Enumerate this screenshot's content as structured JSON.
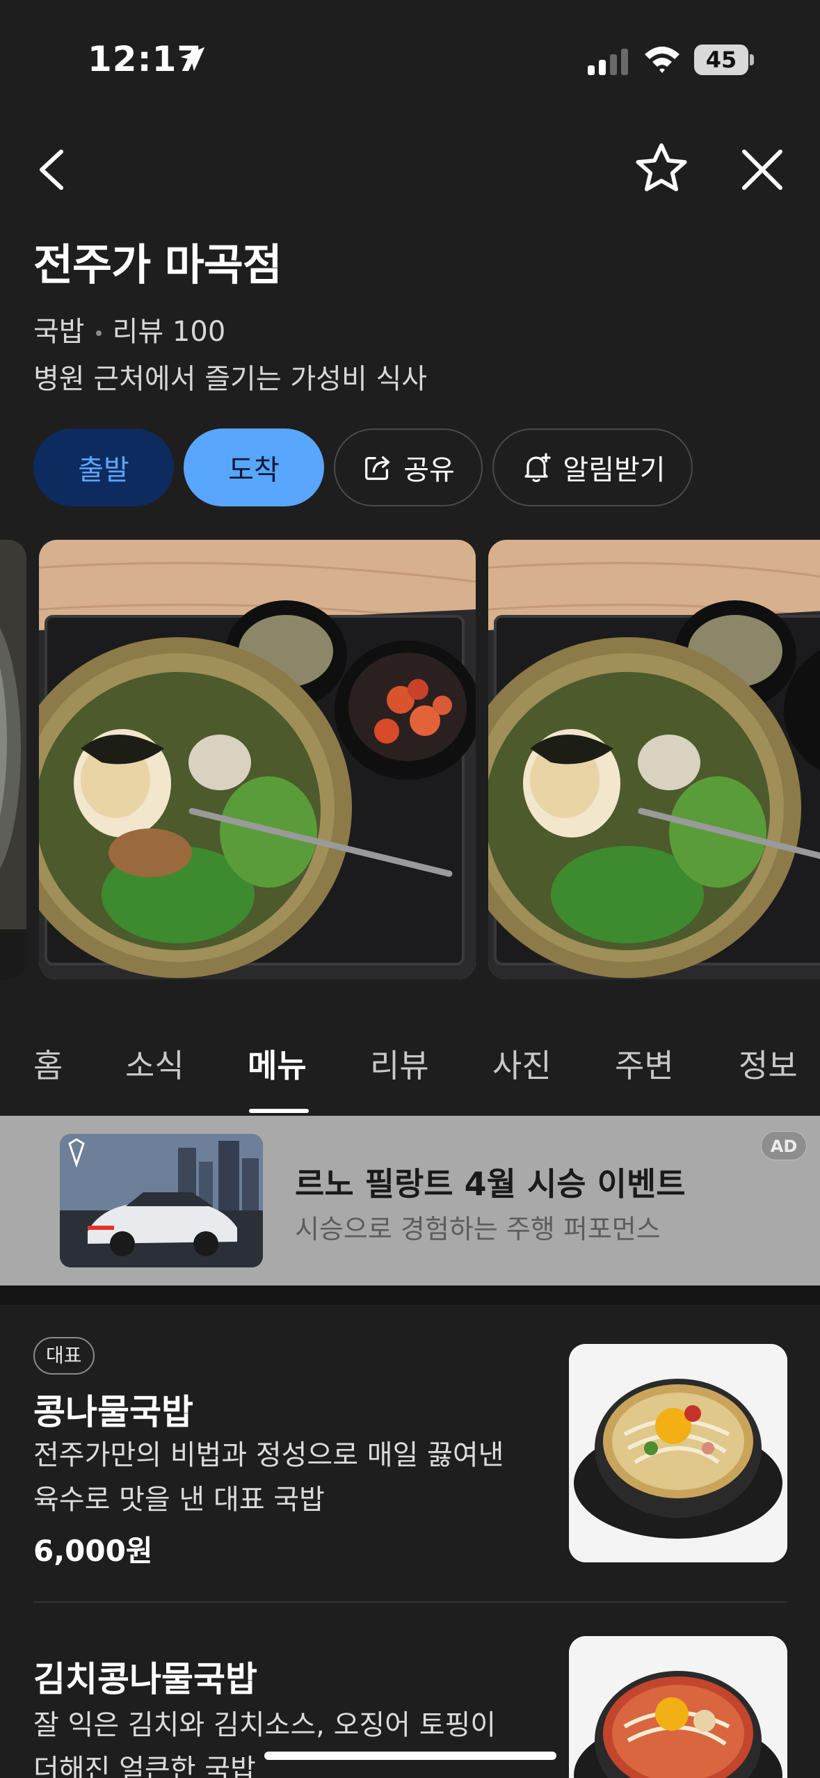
{
  "status_bar": {
    "time": "12:17",
    "battery": "45"
  },
  "place": {
    "name": "전주가 마곡점",
    "category": "국밥",
    "review": "리뷰 100",
    "description": "병원 근처에서 즐기는 가성비 식사"
  },
  "actions": {
    "depart": "출발",
    "arrive": "도착",
    "share": "공유",
    "alert": "알림받기"
  },
  "tabs": [
    "홈",
    "소식",
    "메뉴",
    "리뷰",
    "사진",
    "주변",
    "정보"
  ],
  "active_tab": "메뉴",
  "ad": {
    "title": "르노 필랑트 4월 시승 이벤트",
    "subtitle": "시승으로 경험하는 주행 퍼포먼스",
    "badge": "AD"
  },
  "menu": [
    {
      "badge": "대표",
      "name": "콩나물국밥",
      "desc_line1": "전주가만의 비법과 정성으로 매일 끓여낸",
      "desc_line2": "육수로 맛을 낸 대표 국밥",
      "price": "6,000원"
    },
    {
      "name": "김치콩나물국밥",
      "desc_line1": "잘 익은 김치와 김치소스, 오징어 토핑이",
      "desc_line2": "더해진 얼큰한 국밥"
    }
  ],
  "colors": {
    "background": "#1e1e1e",
    "depart_bg": "#0d2b5e",
    "depart_text": "#5ea4ff",
    "arrive_bg": "#58a6ff",
    "ad_bg": "#a9a9a9"
  },
  "icons": [
    "location-arrow-icon",
    "signal-icon",
    "wifi-icon",
    "back-icon",
    "star-icon",
    "close-icon",
    "share-icon",
    "bell-plus-icon"
  ]
}
